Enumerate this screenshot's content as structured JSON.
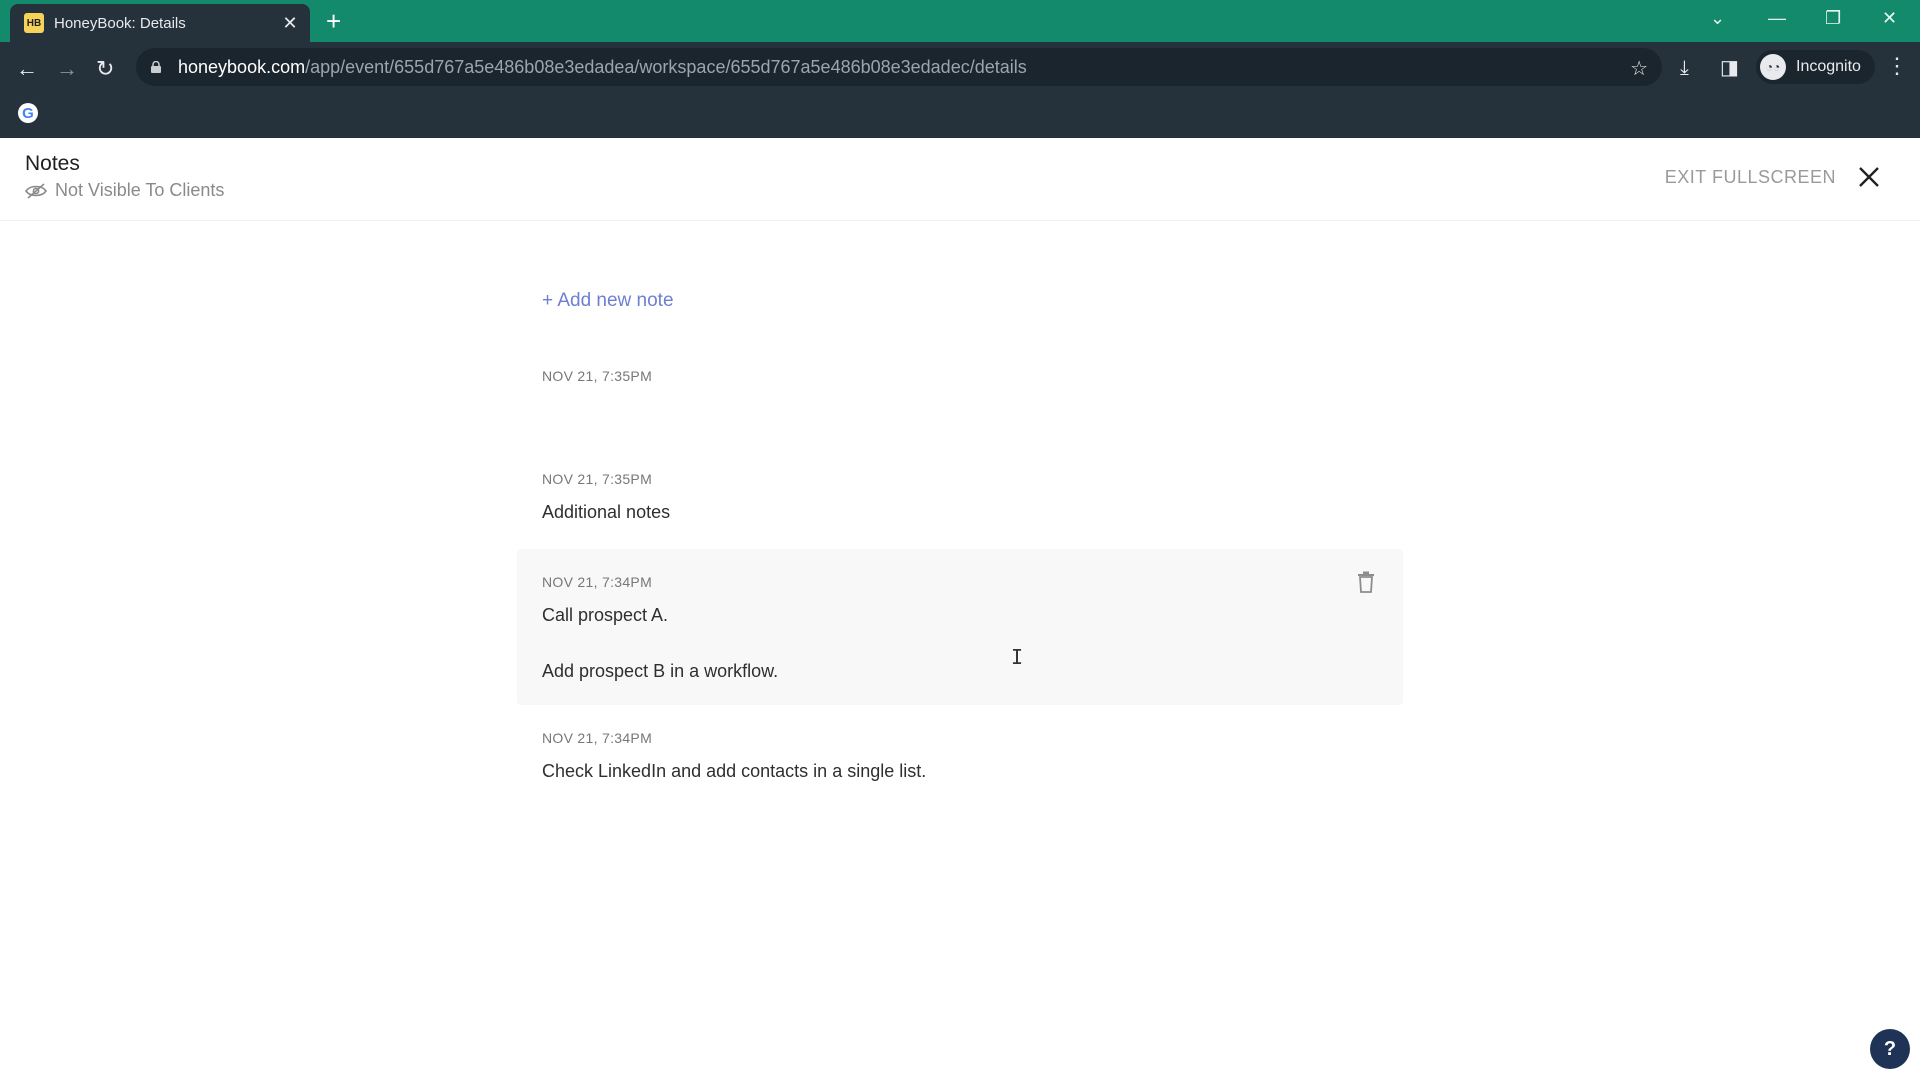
{
  "browser": {
    "tab_title": "HoneyBook: Details",
    "favicon_text": "HB",
    "url_host": "honeybook.com",
    "url_path": "/app/event/655d767a5e486b08e3edadea/workspace/655d767a5e486b08e3edadec/details",
    "profile_label": "Incognito",
    "accent_color": "#138a6b"
  },
  "header": {
    "title": "Notes",
    "visibility": "Not Visible To Clients",
    "exit_label": "EXIT FULLSCREEN"
  },
  "add_note_label": "+ Add new note",
  "notes": [
    {
      "date": "NOV 21, 7:35PM",
      "lines": []
    },
    {
      "date": "NOV 21, 7:35PM",
      "lines": [
        "Additional notes"
      ]
    },
    {
      "date": "NOV 21, 7:34PM",
      "lines": [
        "Call prospect A.",
        "Add prospect B in a workflow."
      ]
    },
    {
      "date": "NOV 21, 7:34PM",
      "lines": [
        "Check LinkedIn and add contacts in a single list."
      ]
    }
  ],
  "help_label": "?"
}
